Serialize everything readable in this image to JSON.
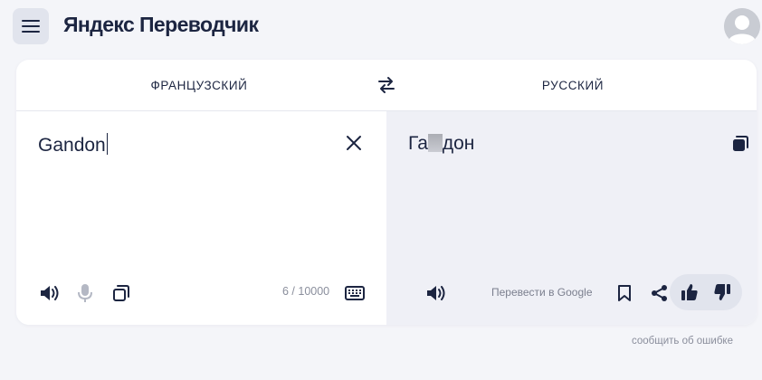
{
  "header": {
    "logo": "Яндекс Переводчик"
  },
  "languages": {
    "source": "ФРАНЦУЗСКИЙ",
    "target": "РУССКИЙ"
  },
  "source": {
    "text": "Gandon",
    "counter": "6 / 10000"
  },
  "target": {
    "text_before": "Га",
    "text_after": "дон",
    "google_link": "Перевести в Google"
  },
  "footer": {
    "report": "сообщить об ошибке"
  },
  "colors": {
    "accent_dark": "#1c2541",
    "background": "#f4f5f9",
    "target_pane": "#eff0f6"
  }
}
